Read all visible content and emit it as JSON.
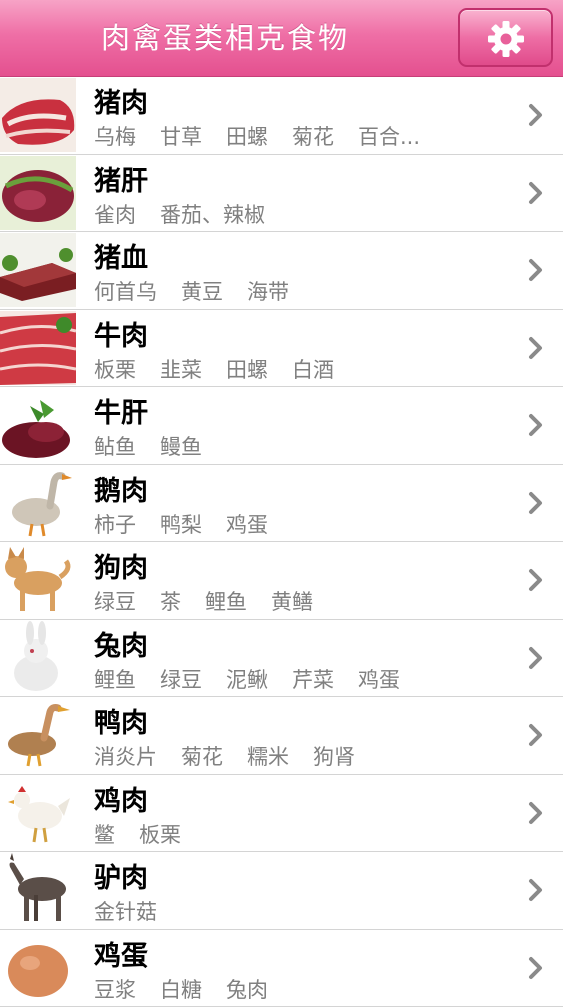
{
  "header": {
    "title": "肉禽蛋类相克食物"
  },
  "settings": {
    "icon": "gear-icon"
  },
  "items": [
    {
      "name": "猪肉",
      "conflicts": [
        "乌梅",
        "甘草",
        "田螺",
        "菊花",
        "百合..."
      ],
      "image": "pork-meat"
    },
    {
      "name": "猪肝",
      "conflicts": [
        "雀肉",
        "番茄、辣椒"
      ],
      "image": "pork-liver"
    },
    {
      "name": "猪血",
      "conflicts": [
        "何首乌",
        "黄豆",
        "海带"
      ],
      "image": "pork-blood"
    },
    {
      "name": "牛肉",
      "conflicts": [
        "板栗",
        "韭菜",
        "田螺",
        "白酒"
      ],
      "image": "beef"
    },
    {
      "name": "牛肝",
      "conflicts": [
        "鲇鱼",
        "鳗鱼"
      ],
      "image": "beef-liver"
    },
    {
      "name": "鹅肉",
      "conflicts": [
        "柿子",
        "鸭梨",
        "鸡蛋"
      ],
      "image": "goose"
    },
    {
      "name": "狗肉",
      "conflicts": [
        "绿豆",
        "茶",
        "鲤鱼",
        "黄鳝"
      ],
      "image": "dog"
    },
    {
      "name": "兔肉",
      "conflicts": [
        "鲤鱼",
        "绿豆",
        "泥鳅",
        "芹菜",
        "鸡蛋"
      ],
      "image": "rabbit"
    },
    {
      "name": "鸭肉",
      "conflicts": [
        "消炎片",
        "菊花",
        "糯米",
        "狗肾"
      ],
      "image": "duck"
    },
    {
      "name": "鸡肉",
      "conflicts": [
        "鳖",
        "板栗"
      ],
      "image": "chicken"
    },
    {
      "name": "驴肉",
      "conflicts": [
        "金针菇"
      ],
      "image": "donkey"
    },
    {
      "name": "鸡蛋",
      "conflicts": [
        "豆浆",
        "白糖",
        "兔肉"
      ],
      "image": "egg"
    }
  ]
}
